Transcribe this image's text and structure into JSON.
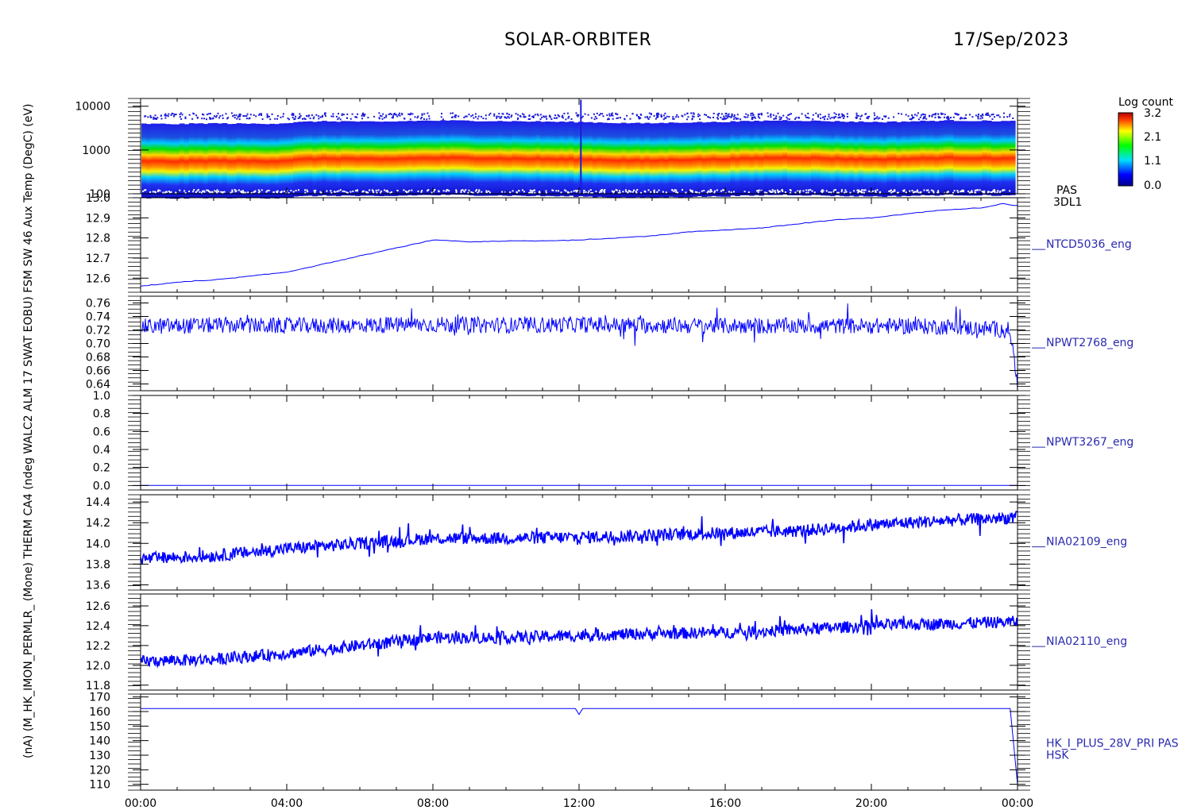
{
  "header": {
    "mission": "SOLAR-ORBITER",
    "date": "17/Sep/2023"
  },
  "colorbar": {
    "label": "Log count",
    "ticks": [
      "3.2",
      "2.1",
      "1.1",
      "0.0"
    ]
  },
  "colors": {
    "series": "#0000ff",
    "axis": "#000000",
    "label": "#2a2ab0"
  },
  "y_axis_overlap_text": "(nA) (M_HK_IMON_PERMLR_ (Mone) THERM CA4 (ndeg WALC2 ALM 17 SWAT EOBU) FSM SW 46 Aux Temp (DegC) (eV)",
  "chart_data": [
    {
      "type": "heatmap",
      "name": "PAS",
      "right_label": [
        "PAS",
        "3DL1"
      ],
      "y_scale": "log",
      "ylim": [
        100,
        15000
      ],
      "yticks": [
        "10000",
        "1000",
        "100"
      ],
      "ytick_values": [
        10000,
        1000,
        100
      ],
      "colorbar_range": [
        0.0,
        3.2
      ],
      "peak_energy_ev": [
        480,
        470,
        500,
        480,
        490,
        590,
        600,
        560,
        620,
        640,
        620,
        600,
        580,
        560,
        520,
        500,
        540,
        560,
        600,
        650,
        620,
        580,
        560,
        600,
        640,
        620,
        600
      ]
    },
    {
      "type": "line",
      "name": "NTCD5036_eng",
      "ylim": [
        12.53,
        13.0
      ],
      "yticks": [
        "13.0",
        "12.9",
        "12.8",
        "12.7",
        "12.6"
      ],
      "ytick_values": [
        13.0,
        12.9,
        12.8,
        12.7,
        12.6
      ],
      "x_hours": [
        0,
        1,
        2,
        3,
        4,
        5,
        6,
        7,
        8,
        9,
        10,
        11,
        12,
        13,
        14,
        15,
        16,
        17,
        18,
        19,
        20,
        21,
        22,
        23,
        23.6,
        24
      ],
      "values": [
        12.56,
        12.58,
        12.59,
        12.61,
        12.63,
        12.67,
        12.71,
        12.75,
        12.79,
        12.78,
        12.785,
        12.785,
        12.79,
        12.8,
        12.81,
        12.83,
        12.84,
        12.85,
        12.87,
        12.89,
        12.9,
        12.92,
        12.94,
        12.95,
        12.97,
        12.96
      ]
    },
    {
      "type": "line",
      "name": "NPWT2768_eng",
      "ylim": [
        0.63,
        0.77
      ],
      "yticks": [
        "0.76",
        "0.74",
        "0.72",
        "0.70",
        "0.68",
        "0.66",
        "0.64"
      ],
      "ytick_values": [
        0.76,
        0.74,
        0.72,
        0.7,
        0.68,
        0.66,
        0.64
      ],
      "x_hours": [
        0,
        2,
        4,
        6,
        8,
        10,
        12,
        14,
        16,
        18,
        20,
        22,
        23.8,
        24
      ],
      "values": [
        0.725,
        0.727,
        0.726,
        0.727,
        0.728,
        0.727,
        0.728,
        0.727,
        0.726,
        0.726,
        0.726,
        0.725,
        0.72,
        0.635
      ]
    },
    {
      "type": "line",
      "name": "NPWT3267_eng",
      "ylim": [
        -0.05,
        1.0
      ],
      "yticks": [
        "1.0",
        "0.8",
        "0.6",
        "0.4",
        "0.2",
        "0.0"
      ],
      "ytick_values": [
        1.0,
        0.8,
        0.6,
        0.4,
        0.2,
        0.0
      ],
      "x_hours": [
        0,
        24
      ],
      "values": [
        0.0,
        0.0
      ]
    },
    {
      "type": "line",
      "name": "NIA02109_eng",
      "ylim": [
        13.55,
        14.47
      ],
      "yticks": [
        "14.4",
        "14.2",
        "14.0",
        "13.8",
        "13.6"
      ],
      "ytick_values": [
        14.4,
        14.2,
        14.0,
        13.8,
        13.6
      ],
      "x_hours": [
        0,
        2,
        4,
        6,
        8,
        10,
        12,
        14,
        16,
        18,
        20,
        22,
        24
      ],
      "values": [
        13.85,
        13.88,
        13.95,
        14.0,
        14.05,
        14.05,
        14.06,
        14.08,
        14.1,
        14.12,
        14.18,
        14.22,
        14.25
      ]
    },
    {
      "type": "line",
      "name": "NIA02110_eng",
      "ylim": [
        11.75,
        12.72
      ],
      "yticks": [
        "12.6",
        "12.4",
        "12.2",
        "12.0",
        "11.8"
      ],
      "ytick_values": [
        12.6,
        12.4,
        12.2,
        12.0,
        11.8
      ],
      "x_hours": [
        0,
        2,
        4,
        6,
        8,
        10,
        12,
        14,
        16,
        18,
        20,
        22,
        24
      ],
      "values": [
        12.04,
        12.06,
        12.12,
        12.2,
        12.28,
        12.28,
        12.3,
        12.32,
        12.33,
        12.36,
        12.4,
        12.42,
        12.44
      ]
    },
    {
      "type": "line",
      "name": "HK_I_PLUS_28V_PRI PAS",
      "right_label": [
        "HK_I_PLUS_28V_PRI PAS",
        "HSK"
      ],
      "ylim": [
        106,
        172
      ],
      "yticks": [
        "170",
        "160",
        "150",
        "140",
        "130",
        "120",
        "110"
      ],
      "ytick_values": [
        170,
        160,
        150,
        140,
        130,
        120,
        110
      ],
      "x_hours": [
        0,
        11.9,
        12.0,
        12.1,
        23.8,
        24
      ],
      "values": [
        162,
        162,
        158,
        162,
        162,
        110
      ]
    }
  ],
  "x_axis": {
    "ticks": [
      "00:00",
      "04:00",
      "08:00",
      "12:00",
      "16:00",
      "20:00",
      "00:00"
    ],
    "tick_hours": [
      0,
      4,
      8,
      12,
      16,
      20,
      24
    ]
  }
}
